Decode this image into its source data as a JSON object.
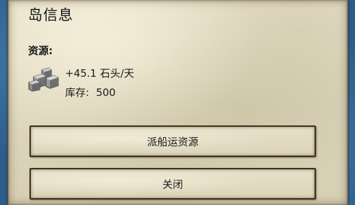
{
  "panel": {
    "title": "岛信息",
    "resources_label": "资源:"
  },
  "resource": {
    "icon": "stone-icon",
    "rate": "+45.1 石头/天",
    "stock_label": "库存:",
    "stock_value": "500"
  },
  "buttons": {
    "dispatch_label": "派船运资源",
    "close_label": "关闭"
  },
  "colors": {
    "sea": "#2d5d8b",
    "parchment": "#e2dcc3",
    "border": "#3a2d1c",
    "text": "#1a1a1a"
  }
}
